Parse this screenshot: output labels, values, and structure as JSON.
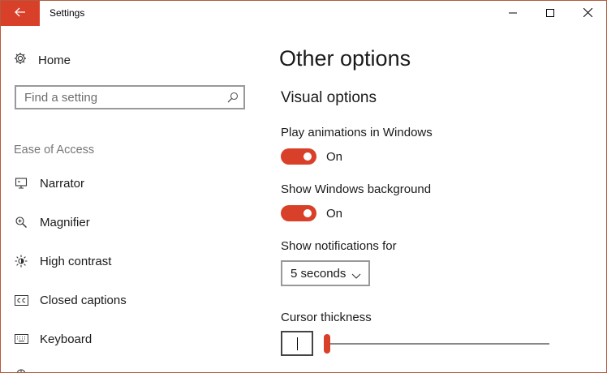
{
  "window": {
    "title": "Settings",
    "accent_color": "#d9402a"
  },
  "titlebar": {
    "back_icon": "back-arrow-icon",
    "minimize_icon": "minimize-icon",
    "maximize_icon": "maximize-icon",
    "close_icon": "close-icon"
  },
  "sidebar": {
    "home": {
      "label": "Home",
      "icon": "gear-icon"
    },
    "search": {
      "placeholder": "Find a setting",
      "icon": "search-icon"
    },
    "section_header": "Ease of Access",
    "items": [
      {
        "label": "Narrator",
        "icon": "narrator-icon"
      },
      {
        "label": "Magnifier",
        "icon": "magnifier-icon"
      },
      {
        "label": "High contrast",
        "icon": "high-contrast-icon"
      },
      {
        "label": "Closed captions",
        "icon": "closed-captions-icon"
      },
      {
        "label": "Keyboard",
        "icon": "keyboard-icon"
      }
    ]
  },
  "main": {
    "page_title": "Other options",
    "visual_options": {
      "heading": "Visual options",
      "play_animations": {
        "label": "Play animations in Windows",
        "state": "On",
        "on": true
      },
      "show_background": {
        "label": "Show Windows background",
        "state": "On",
        "on": true
      },
      "notifications": {
        "label": "Show notifications for",
        "value": "5 seconds"
      },
      "cursor_thickness": {
        "label": "Cursor thickness",
        "value_fraction": 0.0
      }
    }
  }
}
